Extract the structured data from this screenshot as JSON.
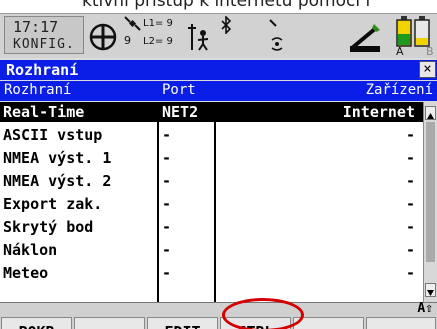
{
  "caption": "ktivní přístup k internetu pomocí l",
  "status": {
    "time": "17:17",
    "mode": "KONFIG.",
    "sat_l1": "L1= 9",
    "sat_l2": "L2= 9",
    "sat_count": "9",
    "icons": [
      "crosshair-icon",
      "satellite-icon",
      "antenna-person-icon",
      "bluetooth-icon",
      "radio-link-icon",
      "stylus-icon",
      "battery-icon"
    ],
    "battery_labels": [
      "A",
      "B"
    ]
  },
  "window": {
    "title": "Rozhraní",
    "close": "×"
  },
  "table": {
    "columns": [
      "Rozhraní",
      "Port",
      "Zařízení"
    ],
    "rows": [
      {
        "name": "Real-Time",
        "port": "NET2",
        "device": "Internet",
        "selected": true
      },
      {
        "name": "ASCII vstup",
        "port": "-",
        "device": "-"
      },
      {
        "name": "NMEA výst. 1",
        "port": "-",
        "device": "-"
      },
      {
        "name": "NMEA výst. 2",
        "port": "-",
        "device": "-"
      },
      {
        "name": "Export zak.",
        "port": "-",
        "device": "-"
      },
      {
        "name": "Skrytý bod",
        "port": "-",
        "device": "-"
      },
      {
        "name": "Náklon",
        "port": "-",
        "device": "-"
      },
      {
        "name": "Meteo",
        "port": "-",
        "device": "-"
      }
    ]
  },
  "indicator": "A⇧",
  "softkeys": [
    "POKR",
    "",
    "EDIT",
    "CTRL",
    "",
    ""
  ],
  "colors": {
    "title_bg": "#0a1ee8",
    "highlight": "#d40000"
  }
}
